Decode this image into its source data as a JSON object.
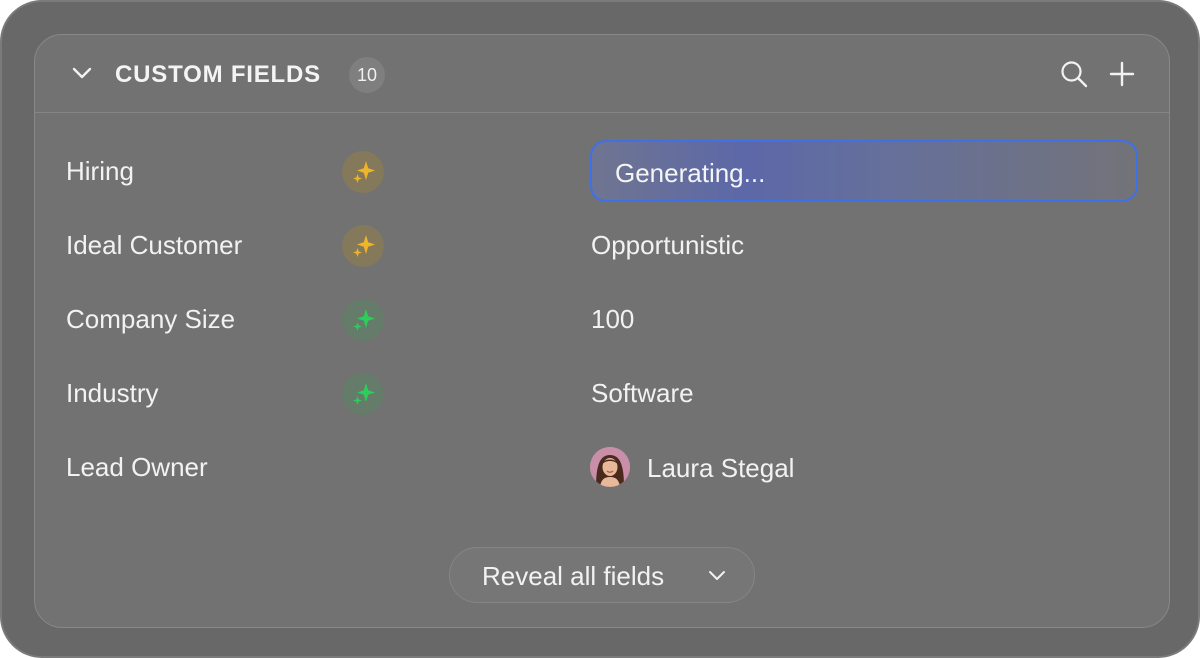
{
  "panel": {
    "title": "CUSTOM FIELDS",
    "count": "10",
    "icons": {
      "collapse": "chevron-down-icon",
      "search": "search-icon",
      "add": "plus-icon"
    }
  },
  "fields": [
    {
      "label": "Hiring",
      "ai_icon": "sparkle-icon",
      "ai_color": "#f0b429",
      "value": ""
    },
    {
      "label": "Ideal Customer",
      "ai_icon": "sparkle-icon",
      "ai_color": "#f0b429",
      "value": "Opportunistic"
    },
    {
      "label": "Company Size",
      "ai_icon": "sparkle-icon",
      "ai_color": "#2ecc5b",
      "value": "100"
    },
    {
      "label": "Industry",
      "ai_icon": "sparkle-icon",
      "ai_color": "#2ecc5b",
      "value": "Software"
    },
    {
      "label": "Lead Owner",
      "value": ""
    }
  ],
  "generating_field": {
    "text": "Generating...",
    "border_color": "#3f70e8"
  },
  "lead_owner": {
    "name": "Laura Stegal",
    "avatar": "avatar-photo"
  },
  "footer": {
    "reveal_label": "Reveal all fields",
    "icon": "chevron-down-icon"
  }
}
